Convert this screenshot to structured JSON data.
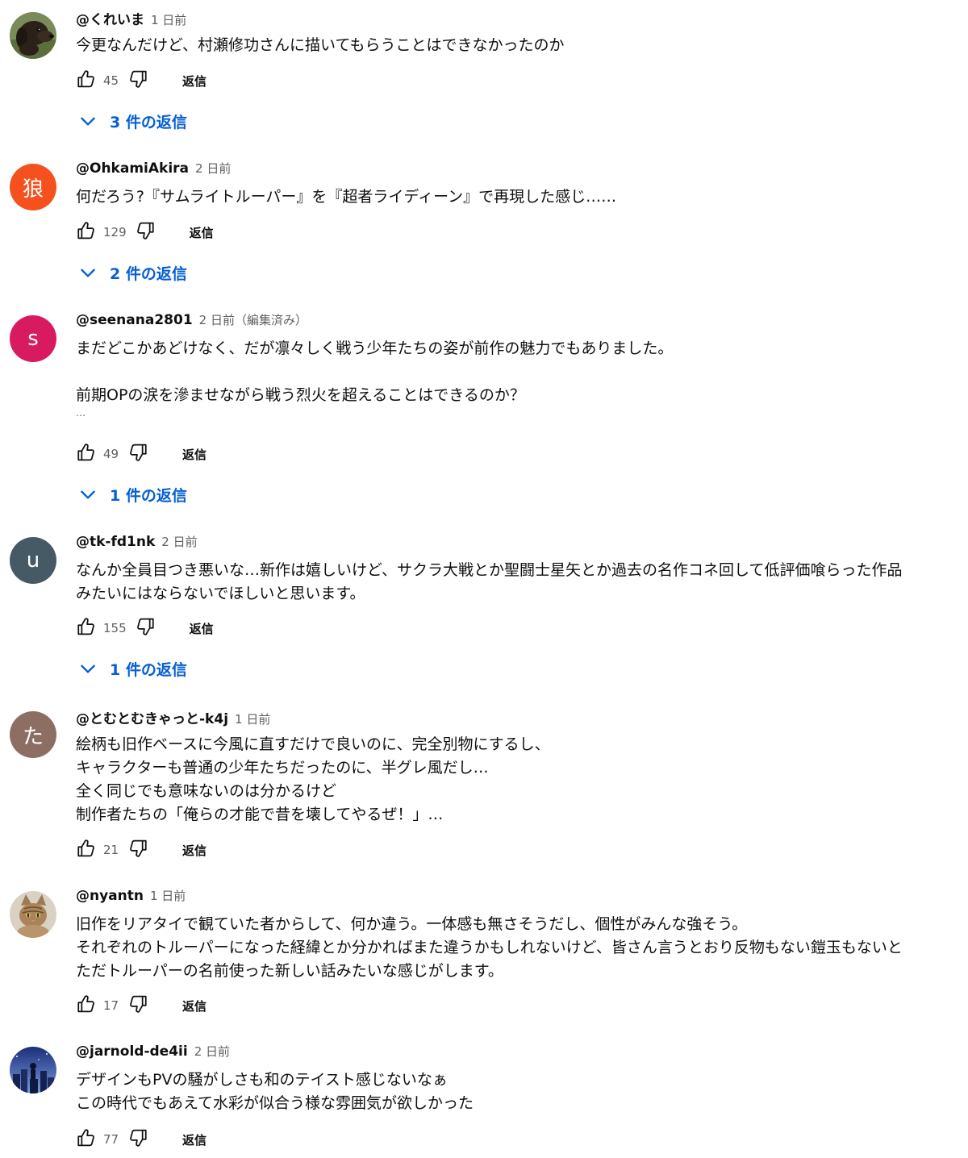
{
  "comments": [
    {
      "author": "@くれいま",
      "time": "1 日前",
      "lines": [
        "今更なんだけど、村瀬修功さんに描いてもらうことはできなかったのか"
      ],
      "likes": "45",
      "reply_label": "返信",
      "replies_label": "3 件の返信",
      "avatar": {
        "type": "image",
        "depicts": "dachshund-dog"
      }
    },
    {
      "author": "@OhkamiAkira",
      "time": "2 日前",
      "lines": [
        "何だろう?『サムライトルーパー』を『超者ライディーン』で再現した感じ……"
      ],
      "likes": "129",
      "reply_label": "返信",
      "replies_label": "2 件の返信",
      "avatar": {
        "type": "letter",
        "letter": "狼",
        "color": "#f4511e"
      }
    },
    {
      "author": "@seenana2801",
      "time": "2 日前（編集済み）",
      "lines": [
        "まだどこかあどけなく、だが凛々しく戦う少年たちの姿が前作の魅力でもありました。",
        "",
        "前期OPの涙を滲ませながら戦う烈火を超えることはできるのか？",
        "…"
      ],
      "likes": "49",
      "reply_label": "返信",
      "replies_label": "1 件の返信",
      "avatar": {
        "type": "letter",
        "letter": "s",
        "color": "#d81b60"
      }
    },
    {
      "author": "@tk-fd1nk",
      "time": "2 日前",
      "lines": [
        "なんか全員目つき悪いな…新作は嬉しいけど、サクラ大戦とか聖闘士星矢とか過去の名作コネ回して低評価喰らった作品",
        "みたいにはならないでほしいと思います。"
      ],
      "likes": "155",
      "reply_label": "返信",
      "replies_label": "1 件の返信",
      "avatar": {
        "type": "letter",
        "letter": "u",
        "color": "#455a64"
      }
    },
    {
      "author": "@とむとむきゃっと-k4j",
      "time": "1 日前",
      "lines": [
        "絵柄も旧作ベースに今風に直すだけで良いのに、完全別物にするし、",
        "キャラクターも普通の少年たちだったのに、半グレ風だし…",
        "全く同じでも意味ないのは分かるけど",
        "制作者たちの「俺らの才能で昔を壊してやるぜ！」…"
      ],
      "likes": "21",
      "reply_label": "返信",
      "replies_label": "",
      "avatar": {
        "type": "letter",
        "letter": "た",
        "color": "#8d6e63"
      }
    },
    {
      "author": "@nyantn",
      "time": "1 日前",
      "lines": [
        "旧作をリアタイで観ていた者からして、何か違う。一体感も無さそうだし、個性がみんな強そう。",
        "それぞれのトルーパーになった経緯とか分かればまた違うかもしれないけど、皆さん言うとおり反物もない鎧玉もないと",
        "ただトルーパーの名前使った新しい話みたいな感じがします。"
      ],
      "likes": "17",
      "reply_label": "返信",
      "replies_label": "",
      "avatar": {
        "type": "image",
        "depicts": "tabby-cat"
      }
    },
    {
      "author": "@jarnold-de4ii",
      "time": "2 日前",
      "lines": [
        "デザインもPVの騒がしさも和のテイスト感じないなぁ",
        "この時代でもあえて水彩が似合う様な雰囲気が欲しかった"
      ],
      "likes": "77",
      "reply_label": "返信",
      "replies_label": "",
      "avatar": {
        "type": "image",
        "depicts": "night-city-figure"
      }
    }
  ]
}
